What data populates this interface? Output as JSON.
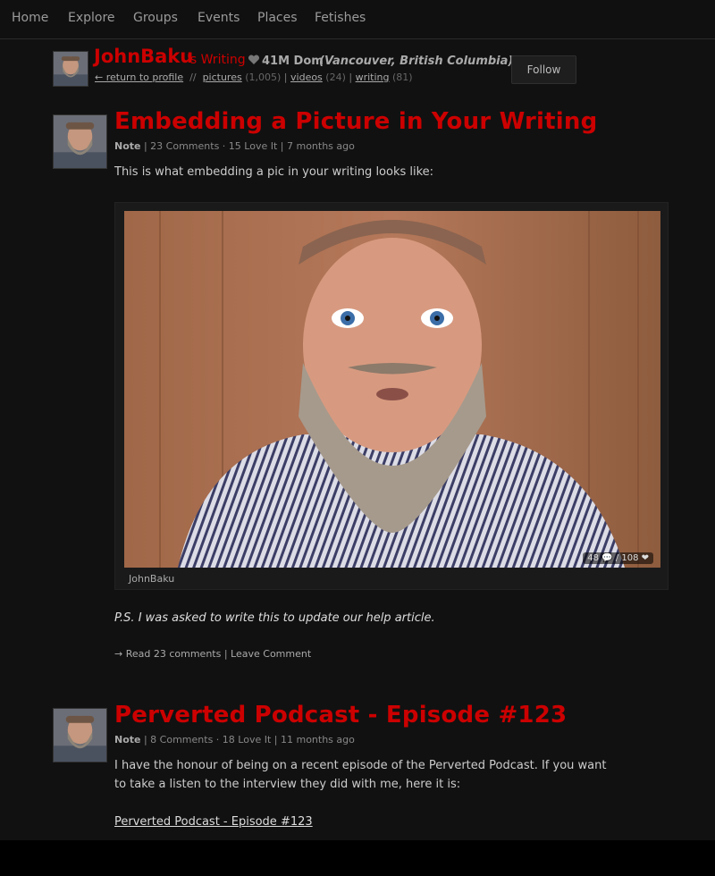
{
  "nav": {
    "items": [
      "Home",
      "Explore",
      "Groups",
      "Events",
      "Places",
      "Fetishes"
    ]
  },
  "profile": {
    "name": "JohnBaku",
    "writing_suffix": "'s Writing",
    "age_role": "41M Dom",
    "location": "(Vancouver, British Columbia)",
    "return_link": "← return to profile",
    "separator": "//",
    "pictures_label": "pictures",
    "pictures_count": "(1,005)",
    "videos_label": "videos",
    "videos_count": "(24)",
    "writing_label": "writing",
    "writing_count": "(81)",
    "pipe": "|",
    "follow_label": "Follow"
  },
  "posts": [
    {
      "title": "Embedding a Picture in Your Writing",
      "type": "Note",
      "meta": " | 23 Comments · 15 Love It | 7 months ago",
      "intro": "This is what embedding a pic in your writing looks like:",
      "image_stats": "48 💬 / 108 ❤",
      "image_caption": "JohnBaku",
      "ps": "P.S. I was asked to write this to update our help article.",
      "read_comments": "→ Read 23 comments",
      "leave_comment": "Leave Comment",
      "links_sep": " | "
    },
    {
      "title": "Perverted Podcast - Episode #123",
      "type": "Note",
      "meta": " | 8 Comments · 18 Love It | 11 months ago",
      "body": "I have the honour of being on a recent episode of the Perverted Podcast. If you want to take a listen to the interview they did with me, here it is:",
      "link": "Perverted Podcast - Episode #123"
    }
  ],
  "colors": {
    "accent": "#cc0000",
    "background": "#000000",
    "panel": "#111111"
  }
}
